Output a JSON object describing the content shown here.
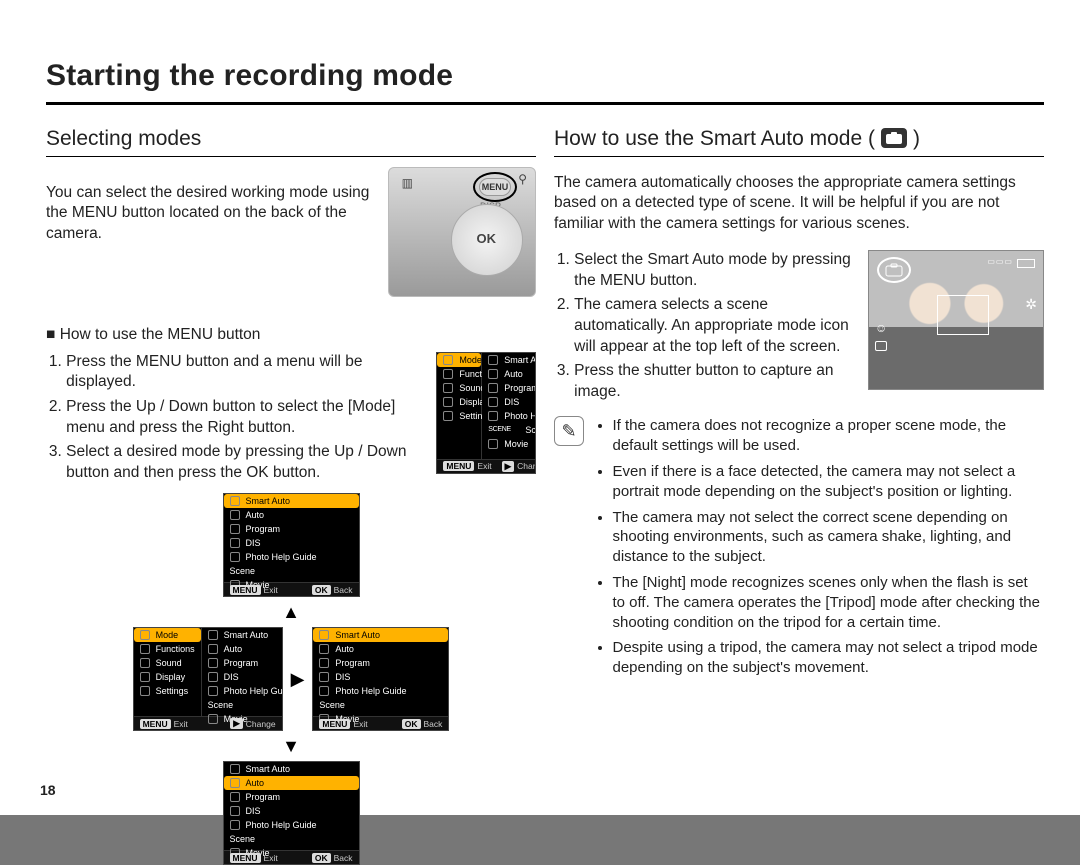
{
  "page_number": "18",
  "main_title": "Starting the recording mode",
  "left": {
    "heading": "Selecting modes",
    "intro": "You can select the desired working mode using the MENU button located on the back of the camera.",
    "how_heading_prefix": "■",
    "how_heading": "How to use the MENU button",
    "steps": [
      "Press the MENU button and a menu will be displayed.",
      "Press the Up / Down button to select the [Mode] menu and press the Right button.",
      "Select a desired mode by pressing the Up / Down button and then press the OK button."
    ],
    "camera_back": {
      "ok_label": "OK",
      "menu_label": "MENU",
      "disp_label": "DISP"
    }
  },
  "right": {
    "heading": "How to use the Smart Auto mode (",
    "heading_close": ")",
    "intro": "The camera automatically chooses the appropriate camera settings based on a detected type of scene. It will be helpful if you are not familiar with the camera settings for various scenes.",
    "steps": [
      "Select the Smart Auto mode by pressing the MENU button.",
      "The camera selects a scene automatically. An appropriate mode icon will appear at the top left of the screen.",
      "Press the shutter button to capture an image."
    ],
    "notes": [
      "If the camera does not recognize a proper scene mode, the default settings will be used.",
      "Even if there is a face detected, the camera may not select a portrait mode depending on the subject's position or lighting.",
      "The camera may not select the correct scene depending on shooting environments, such as camera shake, lighting, and distance to the subject.",
      "The [Night] mode recognizes scenes only when the flash is set to off. The camera operates the [Tripod] mode after checking the shooting condition on the tripod for a certain time.",
      "Despite using a tripod, the camera may not select a tripod mode depending on the subject's movement."
    ]
  },
  "lcd": {
    "left_items": [
      "Mode",
      "Functions",
      "Sound",
      "Display",
      "Settings"
    ],
    "right_items": [
      "Smart Auto",
      "Auto",
      "Program",
      "DIS",
      "Photo Help Guide",
      "Scene",
      "Movie"
    ],
    "scene_prefix": "SCENE",
    "bar_menu_key": "MENU",
    "bar_exit": "Exit",
    "bar_right_key": "▶",
    "bar_change": "Change",
    "bar_ok_key": "OK",
    "bar_back": "Back"
  }
}
